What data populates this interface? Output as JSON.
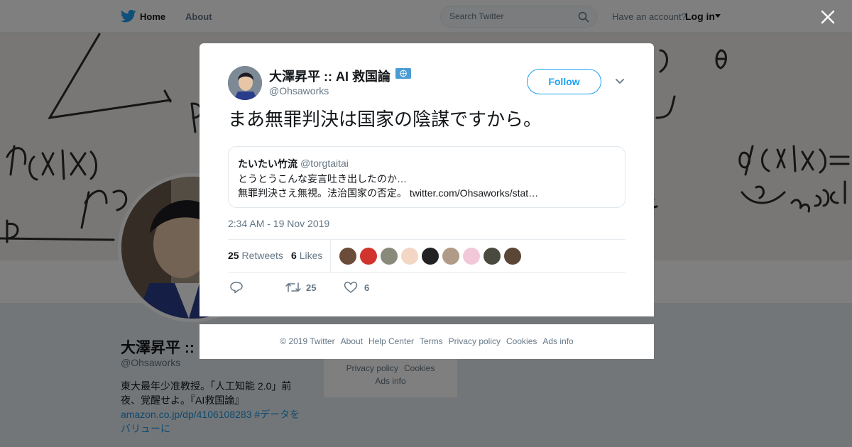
{
  "nav": {
    "home_label": "Home",
    "about_label": "About",
    "search_placeholder": "Search Twitter",
    "have_account": "Have an account?",
    "login_label": "Log in"
  },
  "profile": {
    "name": "大澤昇平 ::",
    "handle": "@Ohsaworks",
    "bio_line1": "東大最年少准教授。「人工知能 2.0」前",
    "bio_line2": "夜、覚醒せよ。『AI救国論』",
    "bio_link": "amazon.co.jp/dp/4106108283",
    "bio_hashtag": "#データを",
    "bio_hashtag2": "バリューに",
    "side_links": [
      "Privacy policy",
      "Cookies",
      "Ads info"
    ]
  },
  "tweet": {
    "author_name": "大澤昇平 :: AI 救国論",
    "author_handle": "@Ohsaworks",
    "follow_label": "Follow",
    "text": "まあ無罪判決は国家の陰謀ですから。",
    "quote": {
      "name": "たいたい竹流",
      "handle": "@torgtaitai",
      "line1": "とうとうこんな妄言吐き出したのか…",
      "line2": "無罪判決さえ無視。法治国家の否定。",
      "link": "twitter.com/Ohsaworks/stat…"
    },
    "timestamp": "2:34 AM - 19 Nov 2019",
    "retweets_count": "25",
    "retweets_label": "Retweets",
    "likes_count": "6",
    "likes_label": "Likes",
    "actions": {
      "reply_count": "",
      "retweet_count": "25",
      "like_count": "6"
    }
  },
  "likers": [
    {
      "color": "#6b4b3a"
    },
    {
      "color": "#d0342c"
    },
    {
      "color": "#8a8a7a"
    },
    {
      "color": "#f3d6c4"
    },
    {
      "color": "#222222"
    },
    {
      "color": "#b09a88"
    },
    {
      "color": "#f2c8d8"
    },
    {
      "color": "#4a4a40"
    },
    {
      "color": "#5b4636"
    }
  ],
  "footer": {
    "links": [
      "© 2019 Twitter",
      "About",
      "Help Center",
      "Terms",
      "Privacy policy",
      "Cookies",
      "Ads info"
    ]
  },
  "colors": {
    "accent": "#1da1f2",
    "link": "#1b95e0",
    "muted": "#657786"
  }
}
